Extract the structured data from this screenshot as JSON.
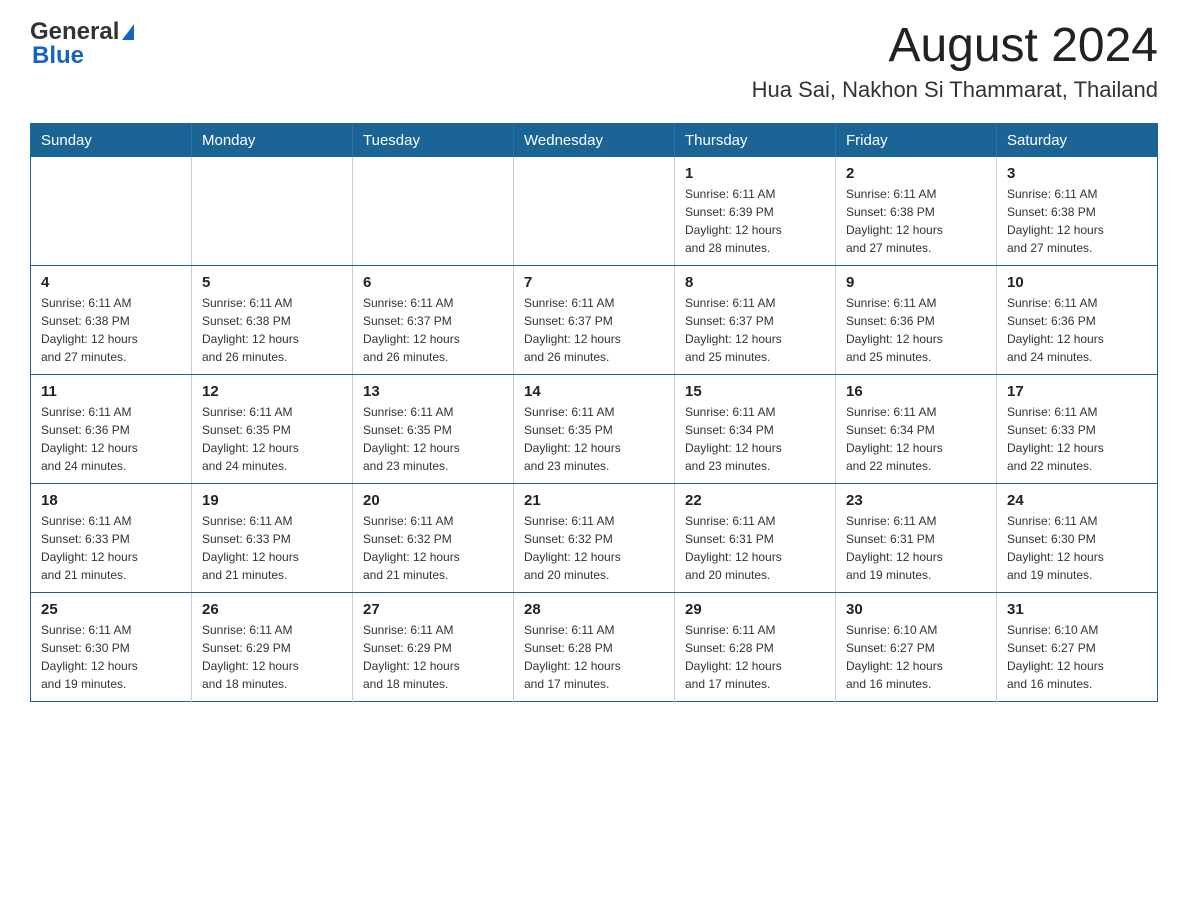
{
  "header": {
    "logo_general": "General",
    "logo_blue": "Blue",
    "title": "August 2024",
    "location": "Hua Sai, Nakhon Si Thammarat, Thailand"
  },
  "weekdays": [
    "Sunday",
    "Monday",
    "Tuesday",
    "Wednesday",
    "Thursday",
    "Friday",
    "Saturday"
  ],
  "weeks": [
    [
      {
        "day": "",
        "info": ""
      },
      {
        "day": "",
        "info": ""
      },
      {
        "day": "",
        "info": ""
      },
      {
        "day": "",
        "info": ""
      },
      {
        "day": "1",
        "info": "Sunrise: 6:11 AM\nSunset: 6:39 PM\nDaylight: 12 hours\nand 28 minutes."
      },
      {
        "day": "2",
        "info": "Sunrise: 6:11 AM\nSunset: 6:38 PM\nDaylight: 12 hours\nand 27 minutes."
      },
      {
        "day": "3",
        "info": "Sunrise: 6:11 AM\nSunset: 6:38 PM\nDaylight: 12 hours\nand 27 minutes."
      }
    ],
    [
      {
        "day": "4",
        "info": "Sunrise: 6:11 AM\nSunset: 6:38 PM\nDaylight: 12 hours\nand 27 minutes."
      },
      {
        "day": "5",
        "info": "Sunrise: 6:11 AM\nSunset: 6:38 PM\nDaylight: 12 hours\nand 26 minutes."
      },
      {
        "day": "6",
        "info": "Sunrise: 6:11 AM\nSunset: 6:37 PM\nDaylight: 12 hours\nand 26 minutes."
      },
      {
        "day": "7",
        "info": "Sunrise: 6:11 AM\nSunset: 6:37 PM\nDaylight: 12 hours\nand 26 minutes."
      },
      {
        "day": "8",
        "info": "Sunrise: 6:11 AM\nSunset: 6:37 PM\nDaylight: 12 hours\nand 25 minutes."
      },
      {
        "day": "9",
        "info": "Sunrise: 6:11 AM\nSunset: 6:36 PM\nDaylight: 12 hours\nand 25 minutes."
      },
      {
        "day": "10",
        "info": "Sunrise: 6:11 AM\nSunset: 6:36 PM\nDaylight: 12 hours\nand 24 minutes."
      }
    ],
    [
      {
        "day": "11",
        "info": "Sunrise: 6:11 AM\nSunset: 6:36 PM\nDaylight: 12 hours\nand 24 minutes."
      },
      {
        "day": "12",
        "info": "Sunrise: 6:11 AM\nSunset: 6:35 PM\nDaylight: 12 hours\nand 24 minutes."
      },
      {
        "day": "13",
        "info": "Sunrise: 6:11 AM\nSunset: 6:35 PM\nDaylight: 12 hours\nand 23 minutes."
      },
      {
        "day": "14",
        "info": "Sunrise: 6:11 AM\nSunset: 6:35 PM\nDaylight: 12 hours\nand 23 minutes."
      },
      {
        "day": "15",
        "info": "Sunrise: 6:11 AM\nSunset: 6:34 PM\nDaylight: 12 hours\nand 23 minutes."
      },
      {
        "day": "16",
        "info": "Sunrise: 6:11 AM\nSunset: 6:34 PM\nDaylight: 12 hours\nand 22 minutes."
      },
      {
        "day": "17",
        "info": "Sunrise: 6:11 AM\nSunset: 6:33 PM\nDaylight: 12 hours\nand 22 minutes."
      }
    ],
    [
      {
        "day": "18",
        "info": "Sunrise: 6:11 AM\nSunset: 6:33 PM\nDaylight: 12 hours\nand 21 minutes."
      },
      {
        "day": "19",
        "info": "Sunrise: 6:11 AM\nSunset: 6:33 PM\nDaylight: 12 hours\nand 21 minutes."
      },
      {
        "day": "20",
        "info": "Sunrise: 6:11 AM\nSunset: 6:32 PM\nDaylight: 12 hours\nand 21 minutes."
      },
      {
        "day": "21",
        "info": "Sunrise: 6:11 AM\nSunset: 6:32 PM\nDaylight: 12 hours\nand 20 minutes."
      },
      {
        "day": "22",
        "info": "Sunrise: 6:11 AM\nSunset: 6:31 PM\nDaylight: 12 hours\nand 20 minutes."
      },
      {
        "day": "23",
        "info": "Sunrise: 6:11 AM\nSunset: 6:31 PM\nDaylight: 12 hours\nand 19 minutes."
      },
      {
        "day": "24",
        "info": "Sunrise: 6:11 AM\nSunset: 6:30 PM\nDaylight: 12 hours\nand 19 minutes."
      }
    ],
    [
      {
        "day": "25",
        "info": "Sunrise: 6:11 AM\nSunset: 6:30 PM\nDaylight: 12 hours\nand 19 minutes."
      },
      {
        "day": "26",
        "info": "Sunrise: 6:11 AM\nSunset: 6:29 PM\nDaylight: 12 hours\nand 18 minutes."
      },
      {
        "day": "27",
        "info": "Sunrise: 6:11 AM\nSunset: 6:29 PM\nDaylight: 12 hours\nand 18 minutes."
      },
      {
        "day": "28",
        "info": "Sunrise: 6:11 AM\nSunset: 6:28 PM\nDaylight: 12 hours\nand 17 minutes."
      },
      {
        "day": "29",
        "info": "Sunrise: 6:11 AM\nSunset: 6:28 PM\nDaylight: 12 hours\nand 17 minutes."
      },
      {
        "day": "30",
        "info": "Sunrise: 6:10 AM\nSunset: 6:27 PM\nDaylight: 12 hours\nand 16 minutes."
      },
      {
        "day": "31",
        "info": "Sunrise: 6:10 AM\nSunset: 6:27 PM\nDaylight: 12 hours\nand 16 minutes."
      }
    ]
  ]
}
